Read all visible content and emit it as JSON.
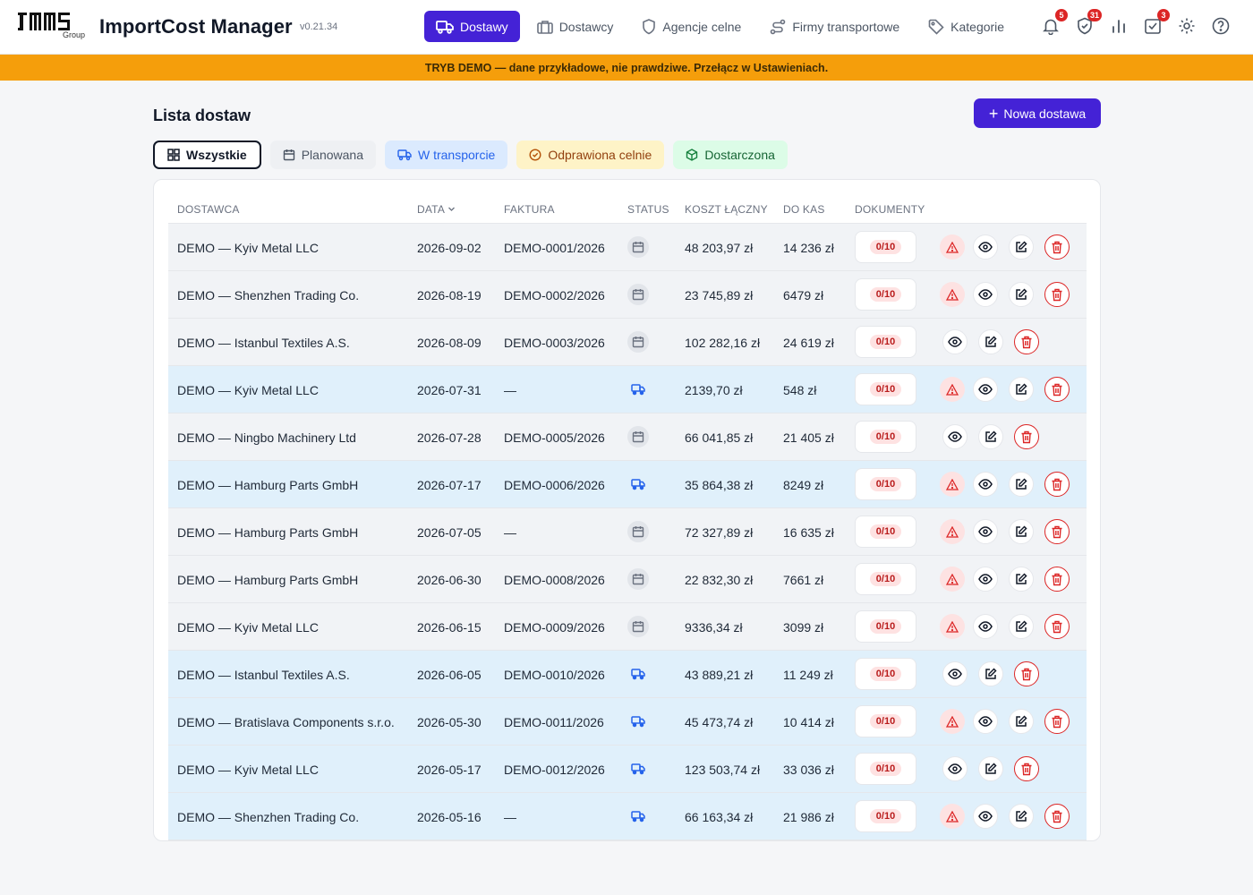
{
  "app": {
    "logo_text": "JMS",
    "logo_sub": "Group",
    "title": "ImportCost Manager",
    "version": "v0.21.34"
  },
  "nav": [
    {
      "label": "Dostawy",
      "icon": "truck-icon",
      "active": true
    },
    {
      "label": "Dostawcy",
      "icon": "briefcase-icon",
      "active": false
    },
    {
      "label": "Agencje celne",
      "icon": "shield-icon",
      "active": false
    },
    {
      "label": "Firmy transportowe",
      "icon": "route-icon",
      "active": false
    },
    {
      "label": "Kategorie",
      "icon": "tag-icon",
      "active": false
    }
  ],
  "header_icons": [
    {
      "name": "bell-icon",
      "badge": "5"
    },
    {
      "name": "shield-alert-icon",
      "badge": "31"
    },
    {
      "name": "bar-chart-icon",
      "badge": ""
    },
    {
      "name": "task-check-icon",
      "badge": "3"
    },
    {
      "name": "gear-icon",
      "badge": ""
    },
    {
      "name": "help-icon",
      "badge": ""
    }
  ],
  "banner": "TRYB DEMO — dane przykładowe, nie prawdziwe. Przełącz w Ustawieniach.",
  "page": {
    "title": "Lista dostaw",
    "new_button": "Nowa dostawa"
  },
  "filters": [
    {
      "label": "Wszystkie",
      "icon": "grid-icon"
    },
    {
      "label": "Planowana",
      "icon": "calendar-icon"
    },
    {
      "label": "W transporcie",
      "icon": "truck-icon"
    },
    {
      "label": "Odprawiona celnie",
      "icon": "check-circle-icon"
    },
    {
      "label": "Dostarczona",
      "icon": "package-icon"
    }
  ],
  "table": {
    "headers": {
      "supplier": "DOSTAWCA",
      "date": "DATA",
      "invoice": "FAKTURA",
      "status": "STATUS",
      "total": "KOSZT ŁĄCZNY",
      "cash": "DO KAS",
      "docs": "DOKUMENTY"
    },
    "rows": [
      {
        "supplier": "DEMO — Kyiv Metal LLC",
        "date": "2026-09-02",
        "invoice": "DEMO-0001/2026",
        "status": "plan",
        "total": "48 203,97 zł",
        "cash": "14 236 zł",
        "docs": "0/10",
        "warn": true
      },
      {
        "supplier": "DEMO — Shenzhen Trading Co.",
        "date": "2026-08-19",
        "invoice": "DEMO-0002/2026",
        "status": "plan",
        "total": "23 745,89 zł",
        "cash": "6479 zł",
        "docs": "0/10",
        "warn": true
      },
      {
        "supplier": "DEMO — Istanbul Textiles A.S.",
        "date": "2026-08-09",
        "invoice": "DEMO-0003/2026",
        "status": "plan",
        "total": "102 282,16 zł",
        "cash": "24 619 zł",
        "docs": "0/10",
        "warn": false
      },
      {
        "supplier": "DEMO — Kyiv Metal LLC",
        "date": "2026-07-31",
        "invoice": "—",
        "status": "trans",
        "total": "2139,70 zł",
        "cash": "548 zł",
        "docs": "0/10",
        "warn": true
      },
      {
        "supplier": "DEMO — Ningbo Machinery Ltd",
        "date": "2026-07-28",
        "invoice": "DEMO-0005/2026",
        "status": "plan",
        "total": "66 041,85 zł",
        "cash": "21 405 zł",
        "docs": "0/10",
        "warn": false
      },
      {
        "supplier": "DEMO — Hamburg Parts GmbH",
        "date": "2026-07-17",
        "invoice": "DEMO-0006/2026",
        "status": "trans",
        "total": "35 864,38 zł",
        "cash": "8249 zł",
        "docs": "0/10",
        "warn": true
      },
      {
        "supplier": "DEMO — Hamburg Parts GmbH",
        "date": "2026-07-05",
        "invoice": "—",
        "status": "plan",
        "total": "72 327,89 zł",
        "cash": "16 635 zł",
        "docs": "0/10",
        "warn": true
      },
      {
        "supplier": "DEMO — Hamburg Parts GmbH",
        "date": "2026-06-30",
        "invoice": "DEMO-0008/2026",
        "status": "plan",
        "total": "22 832,30 zł",
        "cash": "7661 zł",
        "docs": "0/10",
        "warn": true
      },
      {
        "supplier": "DEMO — Kyiv Metal LLC",
        "date": "2026-06-15",
        "invoice": "DEMO-0009/2026",
        "status": "plan",
        "total": "9336,34 zł",
        "cash": "3099 zł",
        "docs": "0/10",
        "warn": true
      },
      {
        "supplier": "DEMO — Istanbul Textiles A.S.",
        "date": "2026-06-05",
        "invoice": "DEMO-0010/2026",
        "status": "trans",
        "total": "43 889,21 zł",
        "cash": "11 249 zł",
        "docs": "0/10",
        "warn": false
      },
      {
        "supplier": "DEMO — Bratislava Components s.r.o.",
        "date": "2026-05-30",
        "invoice": "DEMO-0011/2026",
        "status": "trans",
        "total": "45 473,74 zł",
        "cash": "10 414 zł",
        "docs": "0/10",
        "warn": true
      },
      {
        "supplier": "DEMO — Kyiv Metal LLC",
        "date": "2026-05-17",
        "invoice": "DEMO-0012/2026",
        "status": "trans",
        "total": "123 503,74 zł",
        "cash": "33 036 zł",
        "docs": "0/10",
        "warn": false
      },
      {
        "supplier": "DEMO — Shenzhen Trading Co.",
        "date": "2026-05-16",
        "invoice": "—",
        "status": "trans",
        "total": "66 163,34 zł",
        "cash": "21 986 zł",
        "docs": "0/10",
        "warn": true
      }
    ]
  },
  "colors": {
    "primary": "#4422d6",
    "banner": "#f59e0b",
    "danger": "#dc2626",
    "planned_row": "#f1f3f6",
    "transit_row": "#e0f0fb"
  }
}
